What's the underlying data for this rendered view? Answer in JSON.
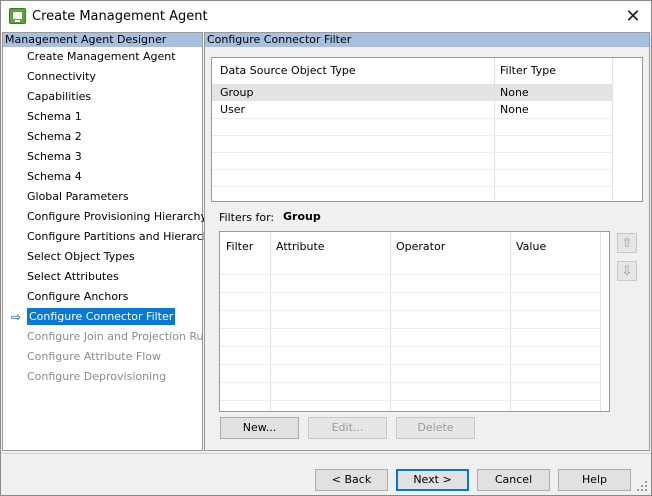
{
  "window": {
    "title": "Create Management Agent",
    "close_glyph": "✕"
  },
  "left_panel": {
    "header": "Management Agent Designer",
    "items": [
      {
        "label": "Create Management Agent",
        "state": "enabled"
      },
      {
        "label": "Connectivity",
        "state": "enabled"
      },
      {
        "label": "Capabilities",
        "state": "enabled"
      },
      {
        "label": "Schema 1",
        "state": "enabled"
      },
      {
        "label": "Schema 2",
        "state": "enabled"
      },
      {
        "label": "Schema 3",
        "state": "enabled"
      },
      {
        "label": "Schema 4",
        "state": "enabled"
      },
      {
        "label": "Global Parameters",
        "state": "enabled"
      },
      {
        "label": "Configure Provisioning Hierarchy",
        "state": "enabled"
      },
      {
        "label": "Configure Partitions and Hierarchies",
        "state": "enabled"
      },
      {
        "label": "Select Object Types",
        "state": "enabled"
      },
      {
        "label": "Select Attributes",
        "state": "enabled"
      },
      {
        "label": "Configure Anchors",
        "state": "enabled"
      },
      {
        "label": "Configure Connector Filter",
        "state": "selected"
      },
      {
        "label": "Configure Join and Projection Rules",
        "state": "disabled"
      },
      {
        "label": "Configure Attribute Flow",
        "state": "disabled"
      },
      {
        "label": "Configure Deprovisioning",
        "state": "disabled"
      }
    ]
  },
  "right_panel": {
    "header": "Configure Connector Filter",
    "type_grid": {
      "columns": [
        "Data Source Object Type",
        "Filter Type"
      ],
      "rows": [
        {
          "type": "Group",
          "filter": "None",
          "selected": true
        },
        {
          "type": "User",
          "filter": "None",
          "selected": false
        }
      ]
    },
    "filters_for_label": "Filters for:",
    "filters_for_value": "Group",
    "filter_grid": {
      "columns": [
        "Filter",
        "Attribute",
        "Operator",
        "Value"
      ]
    },
    "move_up_glyph": "⇧",
    "move_down_glyph": "⇩",
    "buttons": {
      "new": "New...",
      "edit": "Edit...",
      "delete": "Delete"
    }
  },
  "footer": {
    "back": "< Back",
    "next": "Next >",
    "cancel": "Cancel",
    "help": "Help"
  },
  "colors": {
    "selection": "#0a78d7",
    "panel_header": "#a7c0e0",
    "primary_border": "#0078d7"
  }
}
